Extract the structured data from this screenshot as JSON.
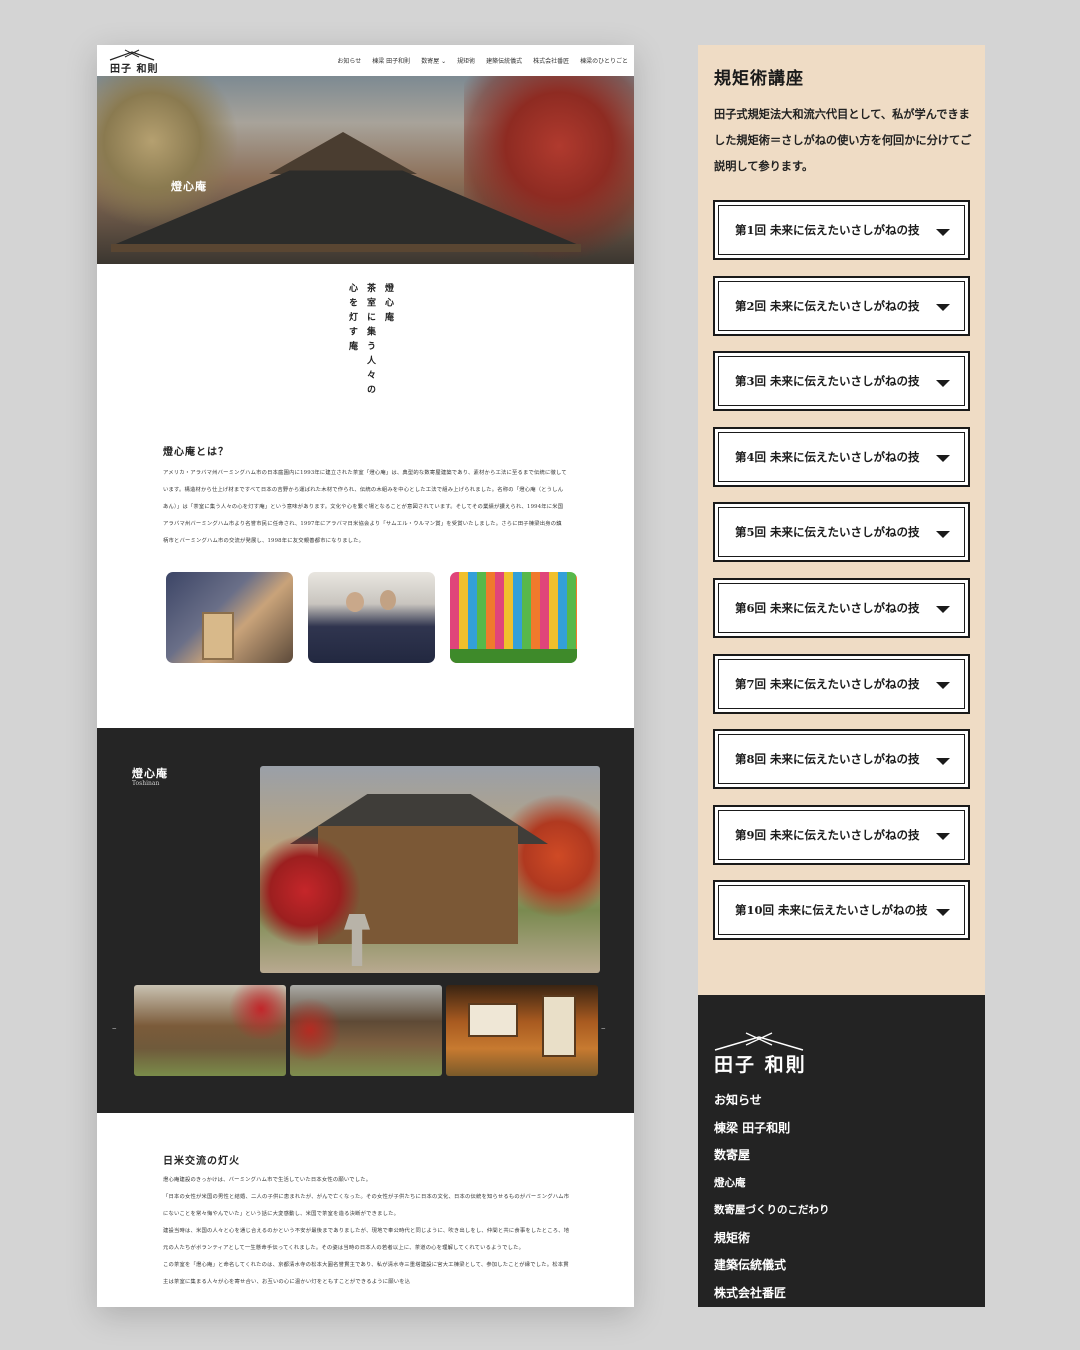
{
  "site": {
    "logo_text": "田子 和則",
    "nav": [
      "お知らせ",
      "棟梁 田子和則",
      "数寄屋 ⌄",
      "規矩術",
      "建築伝統儀式",
      "株式会社番匠",
      "棟梁のひとりごと"
    ]
  },
  "hero": {
    "title": "燈心庵"
  },
  "tagline": {
    "line1": "燈心庵",
    "line2": "茶室に集う人々の",
    "line3": "心を灯す庵"
  },
  "about": {
    "heading": "燈心庵とは？",
    "body": "アメリカ・アラバマ州バーミングハム市の日本庭園内に1993年に建立された茶室「燈心庵」は、典型的な数寄屋建築であり、素材から工法に至るまで伝統に徹しています。構造材から仕上げ材まですべて日本の吉野から運ばれた木材で作られ、伝統の木組みを中心とした工法で組み上げられました。名称の「燈心庵（とうしんあん）」は「茶室に集う人々の心を灯す庵」という意味があります。文化や心を繋ぐ場となることが意図されています。そしてその業績が讃えられ、1994年に米国アラバマ州バーミングハム市より名誉市民に任命され、1997年にアラバマ日米協会より「サムエル・ウルマン賞」を受賞いたしました。さらに田子棟梁出身の鎮柄市とバーミングハム市の交流が発展し、1998年に友交親善都市になりました。"
  },
  "gallery": {
    "title": "燈心庵",
    "subtitle": "Toshinan",
    "prev": "–",
    "next": "–"
  },
  "exchange": {
    "heading": "日米交流の灯火",
    "body": [
      "燈心庵建設のきっかけは、バーミングハム市で生活していた日本女性の願いでした。",
      "「日本の女性が米国の男性と結婚、二人の子供に恵まれたが、がんで亡くなった。その女性が子供たちに日本の文化、日本の伝統を知らせるものがバーミングハム市にないことを常々悔やんでいた」という話に大変感動し、米国で茶室を造る決断ができました。",
      "建設当時は、米国の人々と心を通じ合えるのかという不安が最後までありましたが、現地で奉公時代と同じように、吹き出しをし、仲間と共に食事をしたところ、地元の人たちがボランティアとして一生懸命手伝ってくれました。その姿は当時の日本人の若者以上に、茶道の心を理解してくれているようでした。",
      "この茶室を「燈心庵」と命名してくれたのは、京都清水寺の松本大圓名誉貫主であり、私が清水寺三重塔建設に宮大工棟梁として、参加したことが縁でした。松本貫主は茶室に集まる人々が心を寄せ合い、お互いの心に温かい灯をともすことができるように願いを込"
    ]
  },
  "course": {
    "title": "規矩術講座",
    "intro": "田子式規矩法大和流六代目として、私が学んできました規矩術＝さしがねの使い方を何回かに分けてご説明して参ります。",
    "lessons": [
      "第1回 未来に伝えたいさしがねの技",
      "第2回 未来に伝えたいさしがねの技",
      "第3回 未来に伝えたいさしがねの技",
      "第4回 未来に伝えたいさしがねの技",
      "第5回 未来に伝えたいさしがねの技",
      "第6回 未来に伝えたいさしがねの技",
      "第7回 未来に伝えたいさしがねの技",
      "第8回 未来に伝えたいさしがねの技",
      "第9回 未来に伝えたいさしがねの技",
      "第10回 未来に伝えたいさしがねの技"
    ]
  },
  "footer": {
    "logo_text": "田子 和則",
    "nav": [
      "お知らせ",
      "棟梁 田子和則",
      "数寄屋",
      "燈心庵",
      "数寄屋づくりのこだわり",
      "規矩術",
      "建築伝統儀式",
      "株式会社番匠"
    ]
  },
  "colors": {
    "panel_bg": "#efdcc5",
    "dark_bg": "#252525",
    "footer_bg": "#232323"
  }
}
